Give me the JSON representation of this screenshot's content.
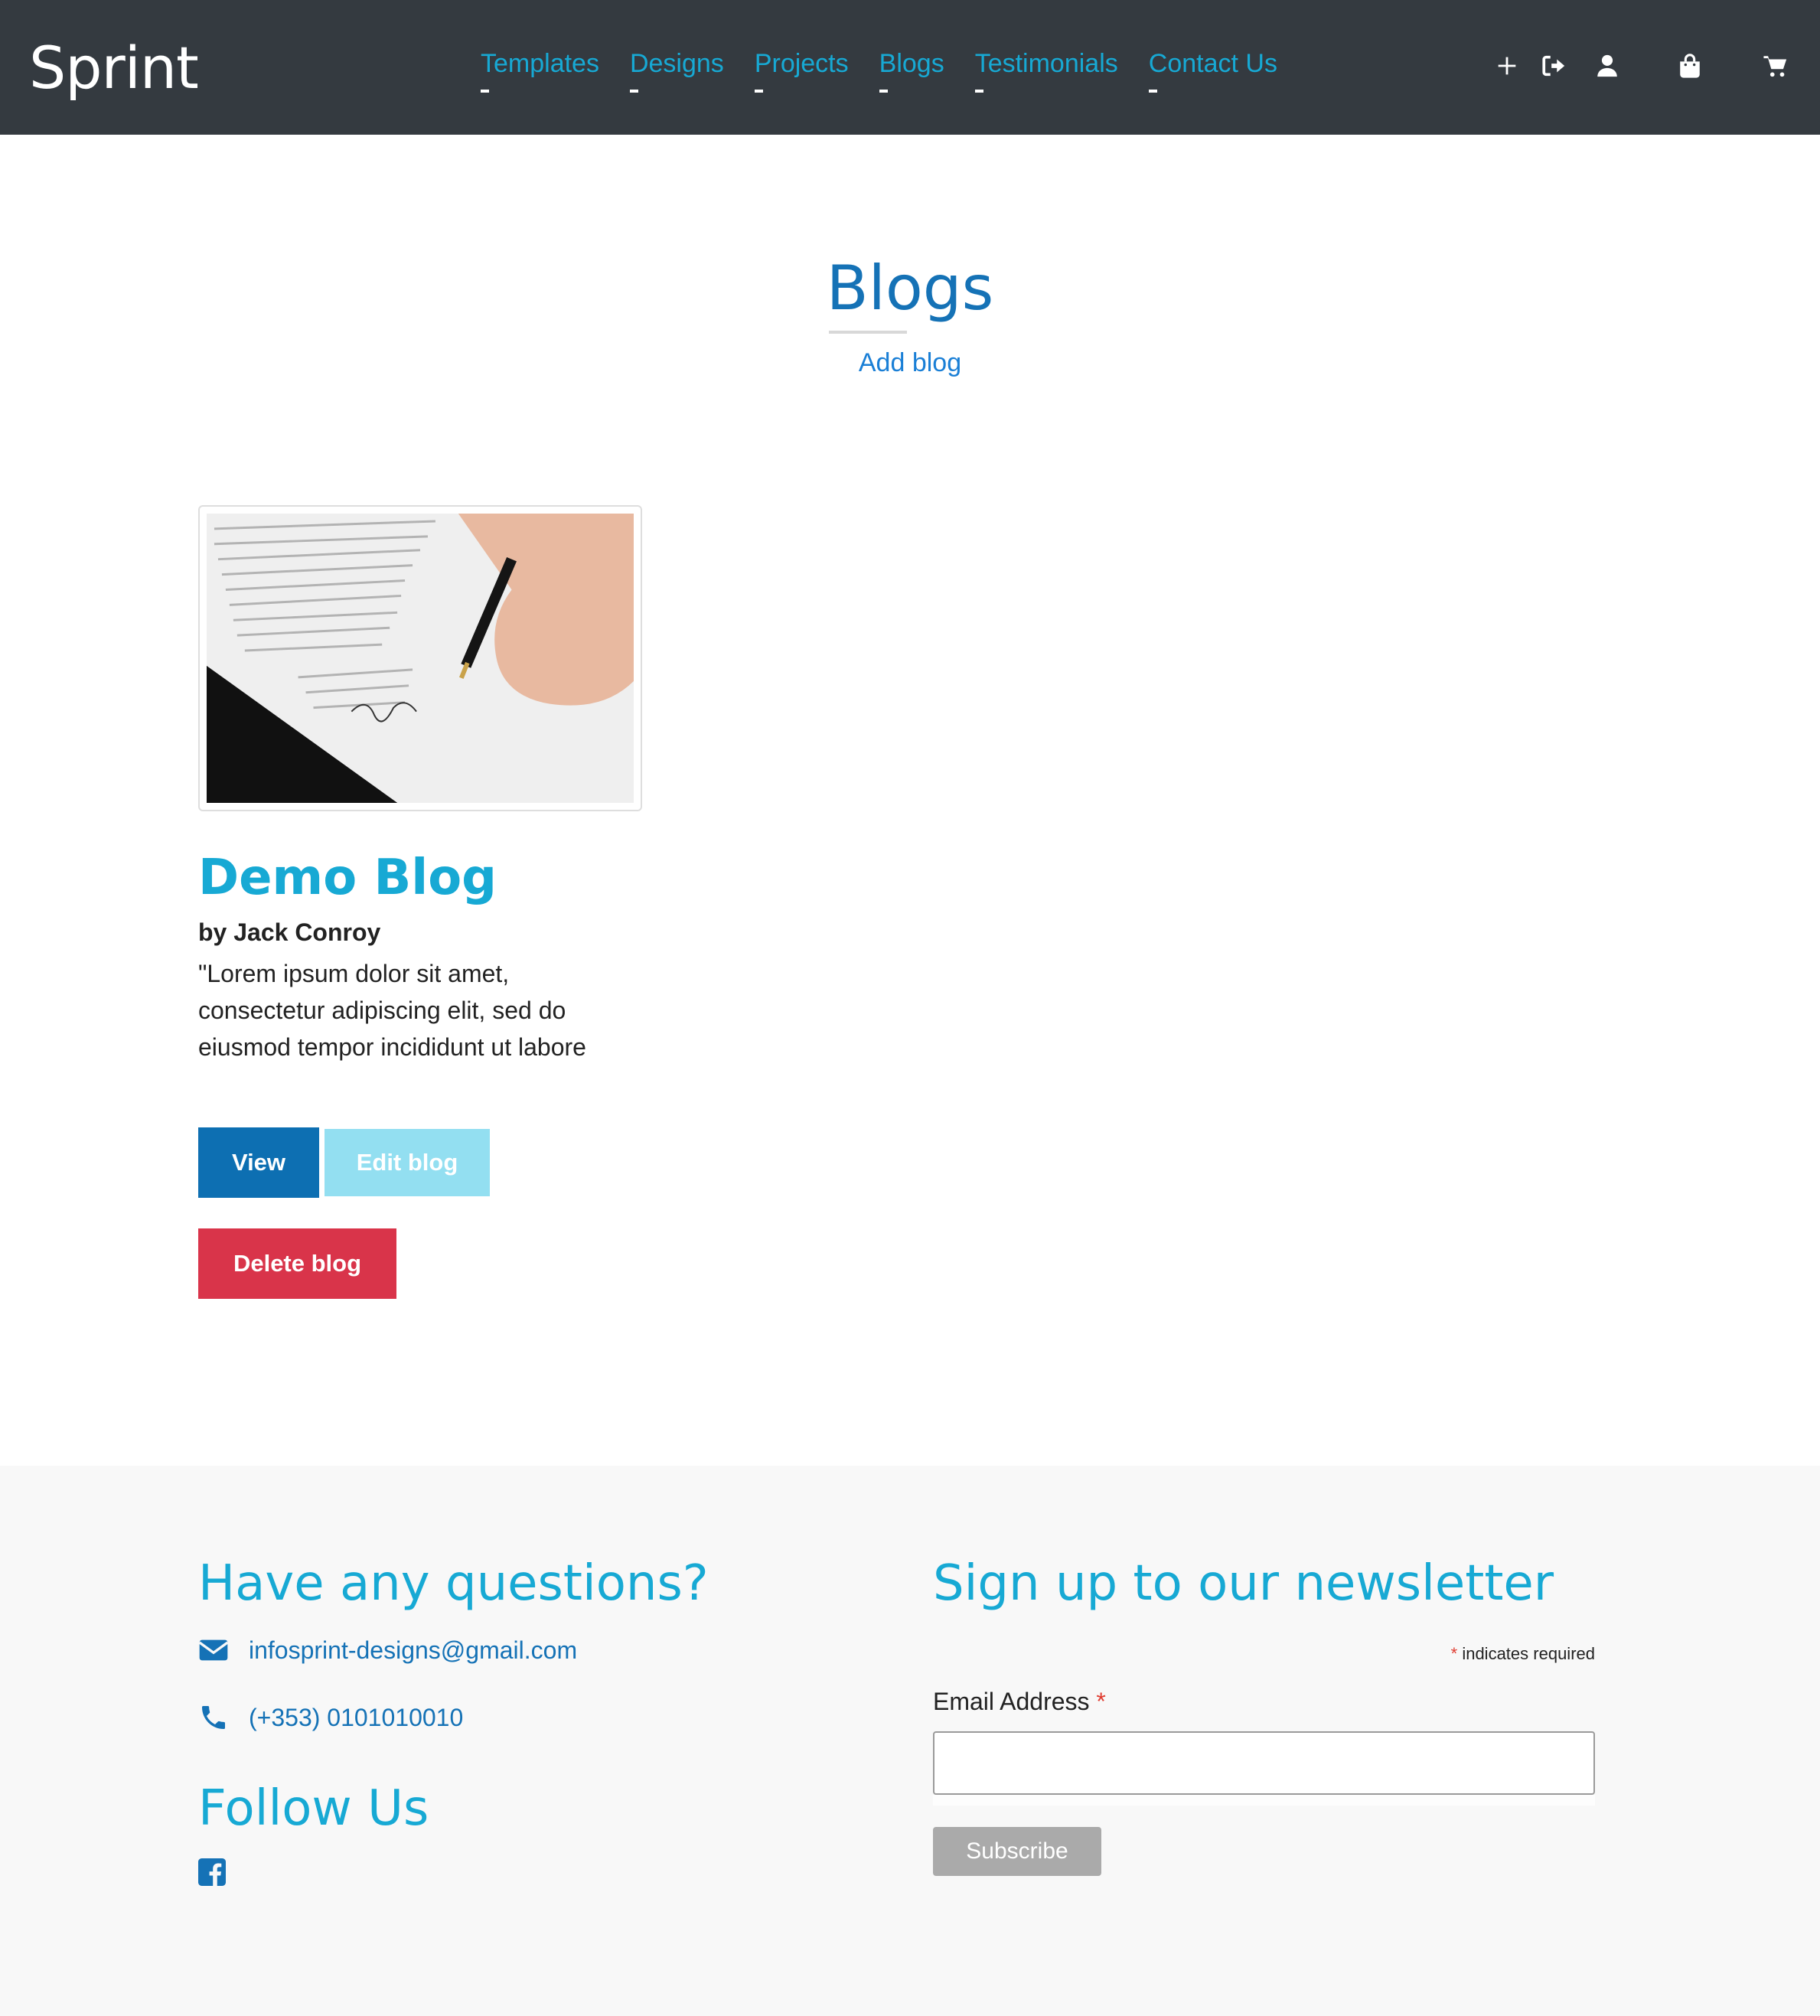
{
  "header": {
    "logo": "Sprint",
    "nav": [
      {
        "label": "Templates"
      },
      {
        "label": "Designs"
      },
      {
        "label": "Projects"
      },
      {
        "label": "Blogs"
      },
      {
        "label": "Testimonials"
      },
      {
        "label": "Contact Us"
      }
    ],
    "icons": [
      "plus-icon",
      "sign-out-icon",
      "user-icon",
      "shopping-bag-icon",
      "cart-icon"
    ]
  },
  "main": {
    "title": "Blogs",
    "add_blog": "Add blog",
    "blogs": [
      {
        "title": "Demo Blog",
        "author": "by Jack Conroy",
        "excerpt": "\"Lorem ipsum dolor sit amet, consectetur adipiscing elit, sed do eiusmod tempor incididunt ut labore",
        "view_label": "View",
        "edit_label": "Edit blog",
        "delete_label": "Delete blog"
      }
    ]
  },
  "footer": {
    "questions_heading": "Have any questions?",
    "email": "infosprint-designs@gmail.com",
    "phone": "(+353) 0101010010",
    "follow_heading": "Follow Us",
    "newsletter_heading": "Sign up to our newsletter",
    "required_note": "indicates required",
    "required_star": "*",
    "email_label": "Email Address",
    "email_value": "",
    "subscribe_label": "Subscribe"
  },
  "colors": {
    "header_bg": "#343a40",
    "accent": "#17a9d4",
    "primary": "#0d6fb2",
    "danger": "#d9344a",
    "info_light": "#93dff1",
    "footer_bg": "#f8f8f8"
  }
}
